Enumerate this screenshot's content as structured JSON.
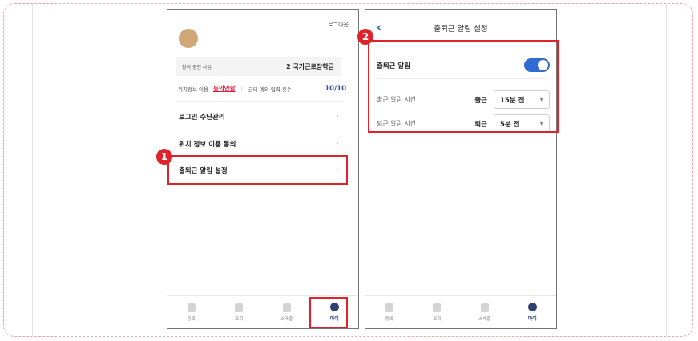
{
  "colors": {
    "accent_red": "#e0232b",
    "brand_navy": "#2d4272",
    "toggle_blue": "#2f6bd1",
    "agree_red": "#e0183a"
  },
  "left_screen": {
    "logout": "로그아웃",
    "business_label": "참여 중인 사업",
    "business_value": "2 국가근로장학금",
    "location_label": "위치정보 이용",
    "location_link": "동의안함",
    "attendance_label": "근태 예외 입력 횟수",
    "attendance_count": "10/10",
    "menu": [
      {
        "label": "로그인 수단관리",
        "icon": "chevron-right-icon"
      },
      {
        "label": "위치 정보 이용 동의",
        "icon": "chevron-right-icon"
      },
      {
        "label": "출퇴근 알림 설정",
        "icon": "chevron-right-icon"
      }
    ]
  },
  "right_screen": {
    "title": "출퇴근 알림 설정",
    "commute_alarm_label": "출퇴근 알림",
    "commute_alarm_on": true,
    "start_time_label": "출근 알림 시간",
    "start_kind": "출근",
    "start_value": "15분 전",
    "end_time_label": "퇴근 알림 시간",
    "end_kind": "퇴근",
    "end_value": "5분 전"
  },
  "tabs": [
    {
      "label": "등록",
      "icon": "register-icon"
    },
    {
      "label": "조회",
      "icon": "search-doc-icon"
    },
    {
      "label": "스케줄",
      "icon": "calendar-icon"
    },
    {
      "label": "마이",
      "icon": "user-icon",
      "active": true
    }
  ],
  "badges": {
    "one": "1",
    "two": "2"
  },
  "chevron": "›",
  "back": "‹",
  "caret": "▼"
}
